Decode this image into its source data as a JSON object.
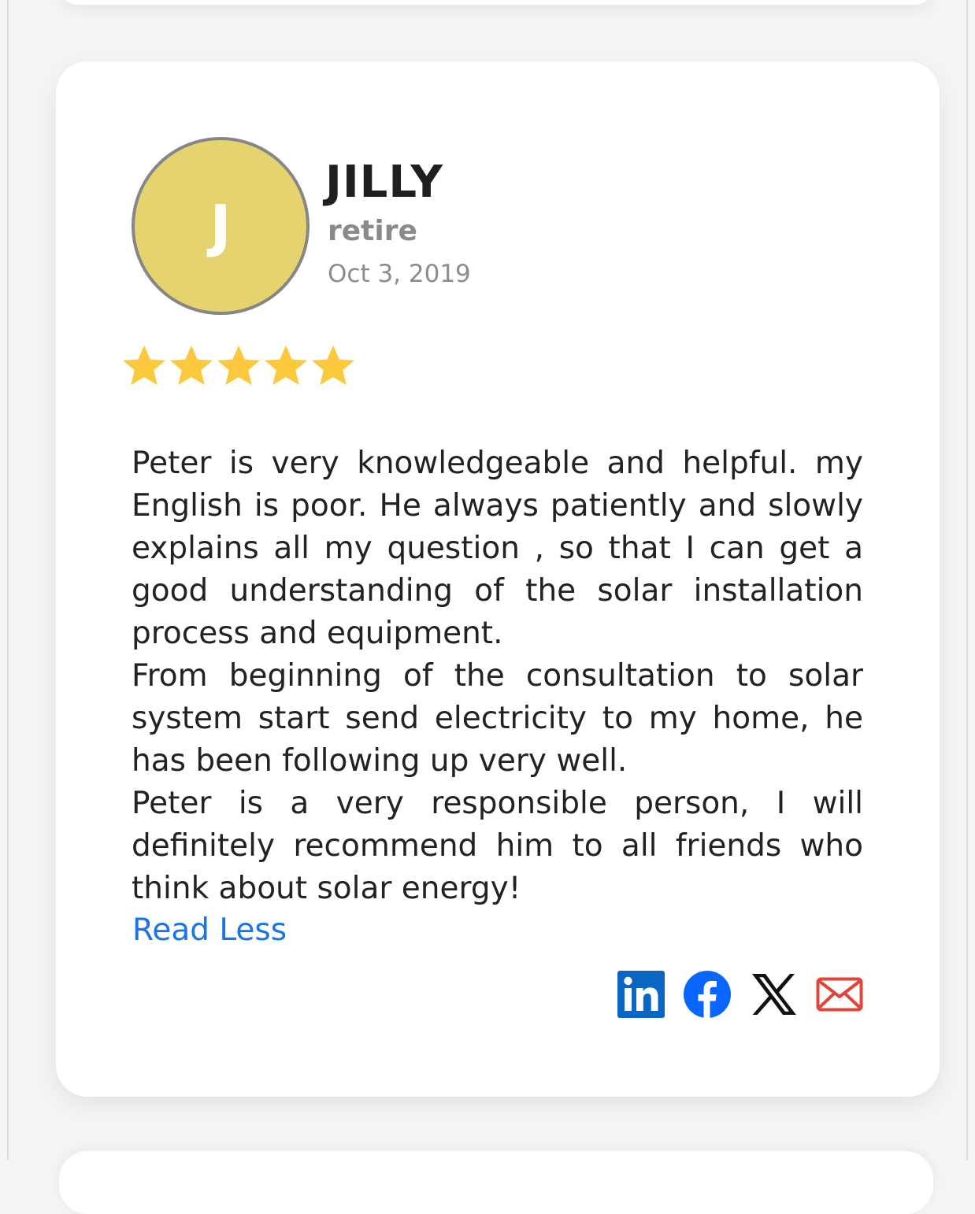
{
  "review": {
    "avatar_initial": "J",
    "name": "JILLY",
    "role": "retire",
    "date": "Oct 3, 2019",
    "rating": 5,
    "rating_max": 5,
    "paragraphs": [
      "Peter is very knowledgeable and helpful. my English is poor. He always patiently and slowly explains all my question , so that I can get a good understanding of the solar installation process and equipment.",
      "From beginning of the consultation to solar system start send electricity to my home, he has been following up very well.",
      "Peter is a very responsible person, I will definitely recommend him to all friends who think about solar energy!"
    ],
    "read_less_label": "Read Less"
  },
  "share": {
    "icons": [
      "linkedin-icon",
      "facebook-icon",
      "x-icon",
      "email-icon"
    ]
  },
  "colors": {
    "avatar_bg": "#e5d36f",
    "star": "#fcc93e",
    "link": "#1a73e8",
    "linkedin": "#0a66c2",
    "facebook": "#0866ff",
    "email": "#e0443a"
  }
}
